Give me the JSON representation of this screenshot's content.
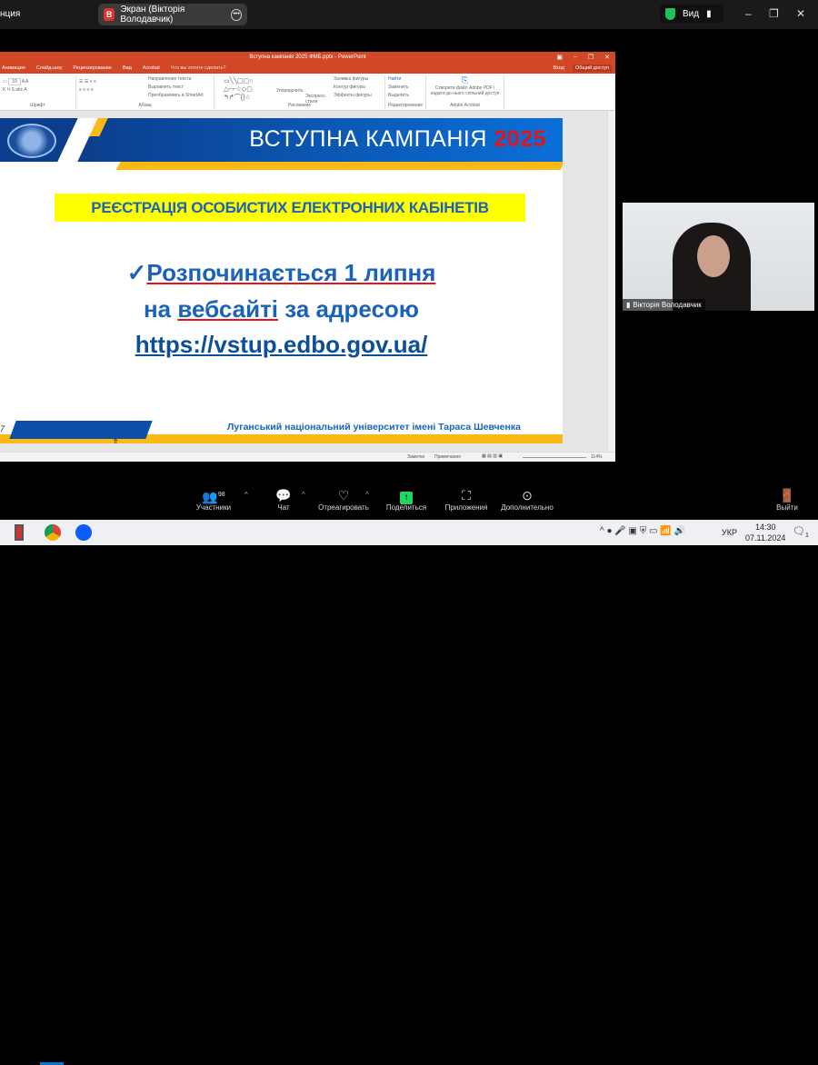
{
  "zoom_window": {
    "left_title_fragment": "нция",
    "share_tab": {
      "avatar_letter": "В",
      "label": "Экран (Вікторія Володавчик)"
    },
    "view_label": "Вид"
  },
  "powerpoint": {
    "title": "Вступна кампанія 2025 ФМБ.pptx - PowerPoint",
    "menu": [
      "Анимация",
      "Слайд-шоу",
      "Рецензирование",
      "Вид",
      "Acrobat",
      "Что вы хотите сделать?"
    ],
    "sign_in": "Вход",
    "share": "Общий доступ",
    "ribbon": {
      "font_group": "Шрифт",
      "font_size": "10",
      "paragraph_items": [
        "Направление текста",
        "Выровнять текст",
        "Преобразовать в SmartArt"
      ],
      "paragraph_group": "Абзац",
      "arrange": "Упорядочить",
      "quick_styles": "Экспресс-стили",
      "shape_items": [
        "Заливка фигуры",
        "Контур фигуры",
        "Эффекты фигуры"
      ],
      "drawing_group": "Рисование",
      "edit_items": [
        "Найти",
        "Заменить",
        "Выделить"
      ],
      "editing_group": "Редактирование",
      "acrobat_button": "Створити файл Adobe PDF і надати до нього спільний доступ",
      "acrobat_group": "Adobe Acrobat"
    },
    "status": {
      "notes": "Заметки",
      "comments": "Примечания",
      "zoom": "114%"
    }
  },
  "slide": {
    "header_title": "ВСТУПНА КАМПАНІЯ",
    "header_year": "2025",
    "highlight": "РЕЄСТРАЦІЯ ОСОБИСТИХ ЕЛЕКТРОННИХ КАБІНЕТІВ",
    "check": "✓",
    "line1": "Розпочинається 1 липня",
    "line2_a": "на ",
    "line2_b": "вебсайті",
    " line2_c": "",
    "line2_rest": " за адресою",
    "url": "https://vstup.edbo.gov.ua/",
    "footer": "Луганський національний університет імені Тараса Шевченка",
    "slide_number": "7"
  },
  "participant": {
    "name": "Вікторія Володавчик"
  },
  "toolbar": {
    "participants": "Участники",
    "participants_count": "98",
    "chat": "Чат",
    "react": "Отреагировать",
    "share": "Поделиться",
    "apps": "Приложения",
    "more": "Дополнительно",
    "leave": "Выйти"
  },
  "taskbar": {
    "lang": "УКР",
    "time": "14:30",
    "date": "07.11.2024",
    "notif": "1"
  }
}
